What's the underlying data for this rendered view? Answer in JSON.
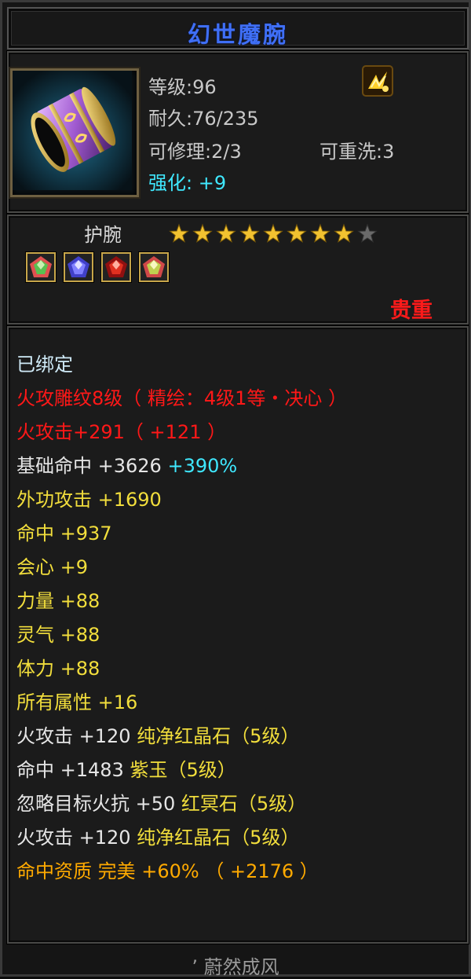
{
  "item": {
    "name": "幻世魔腕",
    "level_line": "等级:96",
    "durability_line": "耐久:76/235",
    "repairable_line": "可修理:2/3",
    "rewashable_line": "可重洗:3",
    "enhance_line": "强化: +9",
    "badge_icon": "gold-badge-icon",
    "type": "护腕",
    "stars_filled": 8,
    "stars_total": 9,
    "rarity": "贵重"
  },
  "gems": [
    {
      "icon": "green-gem-icon",
      "color": "#58c050"
    },
    {
      "icon": "blue-gem-icon",
      "color": "#6a6af0"
    },
    {
      "icon": "red-gem-icon",
      "color": "#d8302a"
    },
    {
      "icon": "green-gem-icon",
      "color": "#c0d050"
    }
  ],
  "attributes": {
    "bound": "已绑定",
    "engraving": "火攻雕纹8级（ 精绘：4级1等・决心 ）",
    "fire_attack_bonus": "火攻击+291（ +121 ）",
    "base_hit_label": "基础命中 +3626",
    "base_hit_pct": "+390%",
    "outer_attack": "外功攻击 +1690",
    "hit": "命中 +937",
    "crit": "会心 +9",
    "strength": "力量 +88",
    "spirit": "灵气 +88",
    "stamina": "体力 +88",
    "all_attr": "所有属性 +16",
    "gem_stat_1": "火攻击 +120",
    "gem_name_1": "纯净红晶石（5级）",
    "gem_stat_2": "命中 +1483",
    "gem_name_2": "紫玉（5级）",
    "gem_stat_3": "忽略目标火抗 +50",
    "gem_name_3": "红冥石（5级）",
    "gem_stat_4": "火攻击 +120",
    "gem_name_4": "纯净红晶石（5级）",
    "aptitude": "命中资质  完美 +60% （ +2176 ）"
  },
  "footer": "’ 蔚然成风",
  "colors": {
    "title": "#3f6ff6",
    "rare_red": "#ff1a1a",
    "yellow": "#f2de3c",
    "cyan": "#3fe8ff",
    "orange": "#ffaa00"
  }
}
